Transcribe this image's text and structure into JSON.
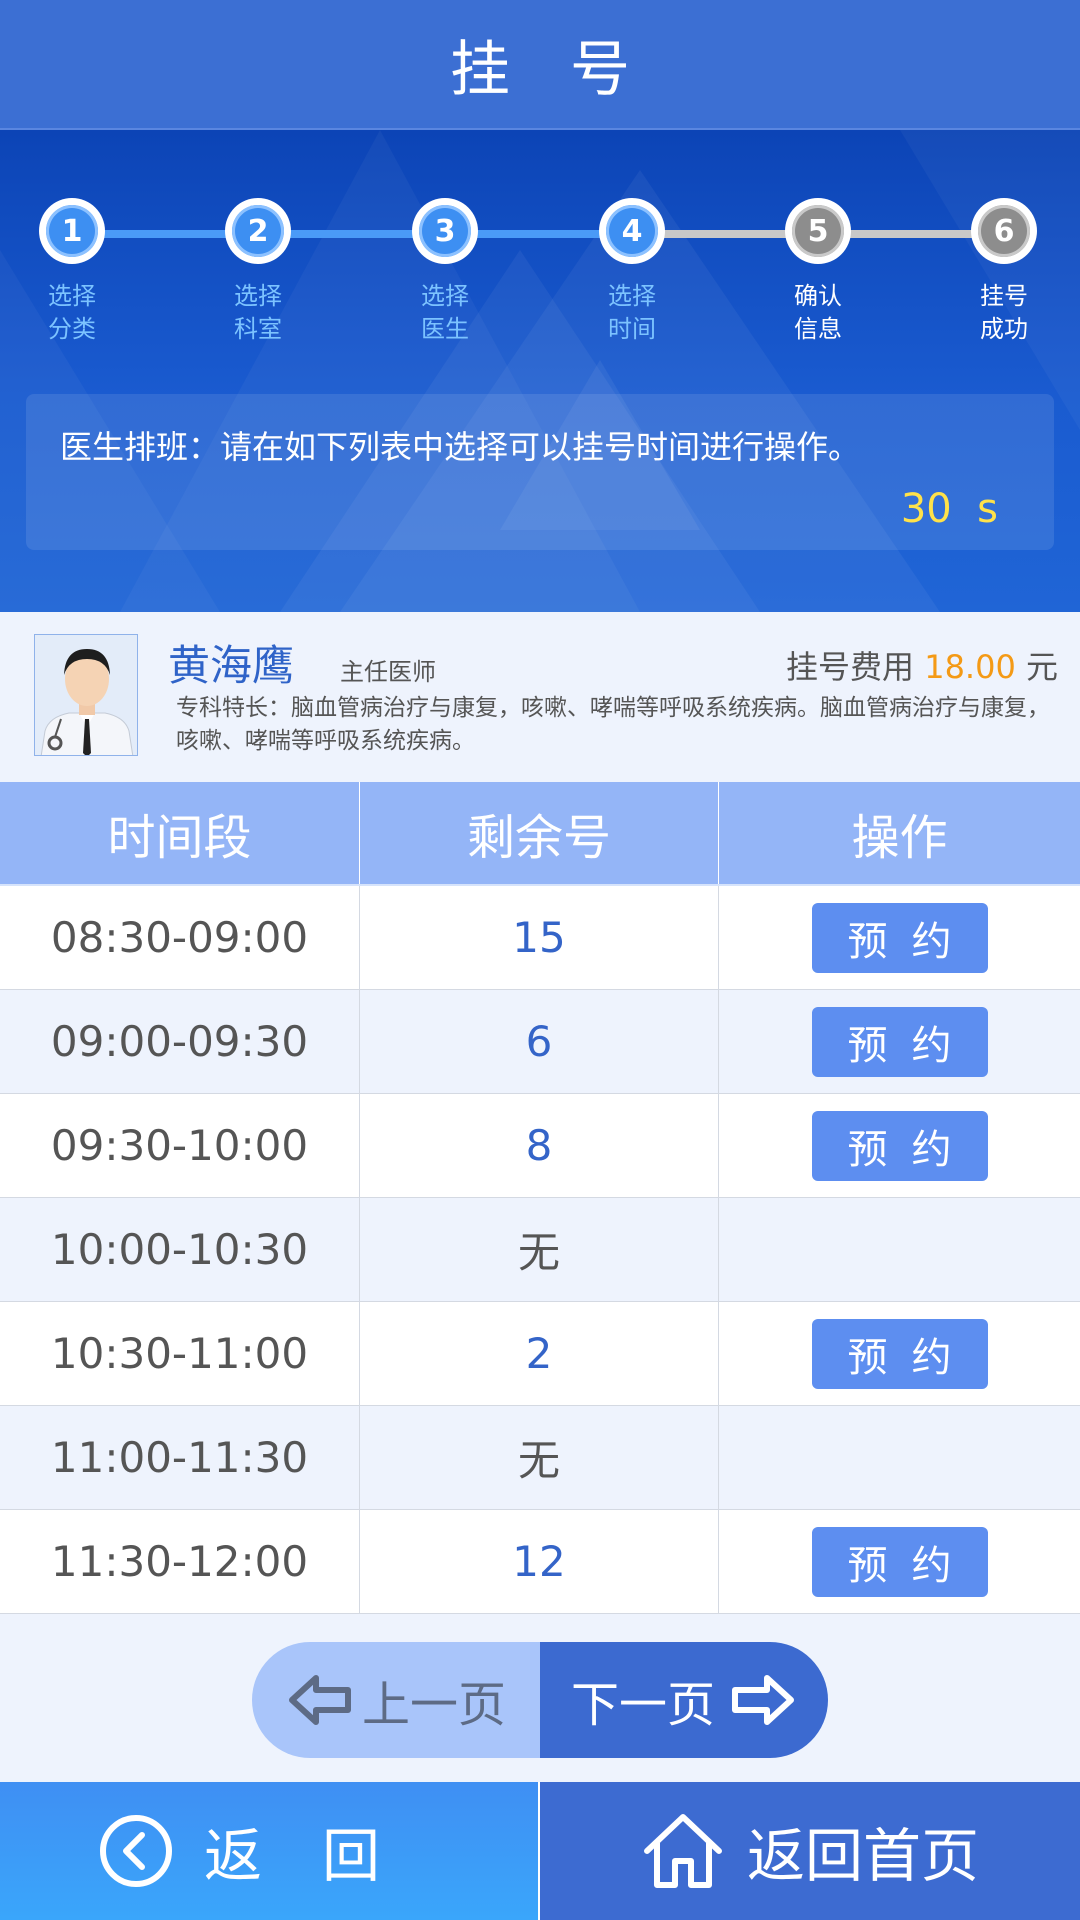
{
  "header": {
    "title": "挂号"
  },
  "steps": [
    {
      "num": "1",
      "label_line1": "选择",
      "label_line2": "分类",
      "state": "done"
    },
    {
      "num": "2",
      "label_line1": "选择",
      "label_line2": "科室",
      "state": "done"
    },
    {
      "num": "3",
      "label_line1": "选择",
      "label_line2": "医生",
      "state": "done"
    },
    {
      "num": "4",
      "label_line1": "选择",
      "label_line2": "时间",
      "state": "done"
    },
    {
      "num": "5",
      "label_line1": "确认",
      "label_line2": "信息",
      "state": "todo"
    },
    {
      "num": "6",
      "label_line1": "挂号",
      "label_line2": "成功",
      "state": "todo"
    }
  ],
  "notice": {
    "text": "医生排班：请在如下列表中选择可以挂号时间进行操作。",
    "countdown": "30  s"
  },
  "doctor": {
    "name": "黄海鹰",
    "title": "主任医师",
    "fee_label": "挂号费用",
    "fee_amount": "18.00",
    "fee_unit": "元",
    "specialty": "专科特长：脑血管病治疗与康复，咳嗽、哮喘等呼吸系统疾病。脑血管病治疗与康复，咳嗽、哮喘等呼吸系统疾病。"
  },
  "table": {
    "headers": [
      "时间段",
      "剩余号",
      "操作"
    ],
    "rows": [
      {
        "time": "08:30-09:00",
        "remaining": "15",
        "action": "预约"
      },
      {
        "time": "09:00-09:30",
        "remaining": "6",
        "action": "预约"
      },
      {
        "time": "09:30-10:00",
        "remaining": "8",
        "action": "预约"
      },
      {
        "time": "10:00-10:30",
        "remaining": "无",
        "action": ""
      },
      {
        "time": "10:30-11:00",
        "remaining": "2",
        "action": "预约"
      },
      {
        "time": "11:00-11:30",
        "remaining": "无",
        "action": ""
      },
      {
        "time": "11:30-12:00",
        "remaining": "12",
        "action": "预约"
      }
    ]
  },
  "pager": {
    "prev_label": "上一页",
    "next_label": "下一页"
  },
  "bottom": {
    "back_label": "返回",
    "home_label": "返回首页"
  },
  "colors": {
    "header": "#3c6fd3",
    "accent_blue": "#3464c8",
    "fee_orange": "#f49a16",
    "countdown_yellow": "#ffe24a",
    "step_done": "#3d8ff2",
    "step_todo": "#8d8d8d"
  }
}
